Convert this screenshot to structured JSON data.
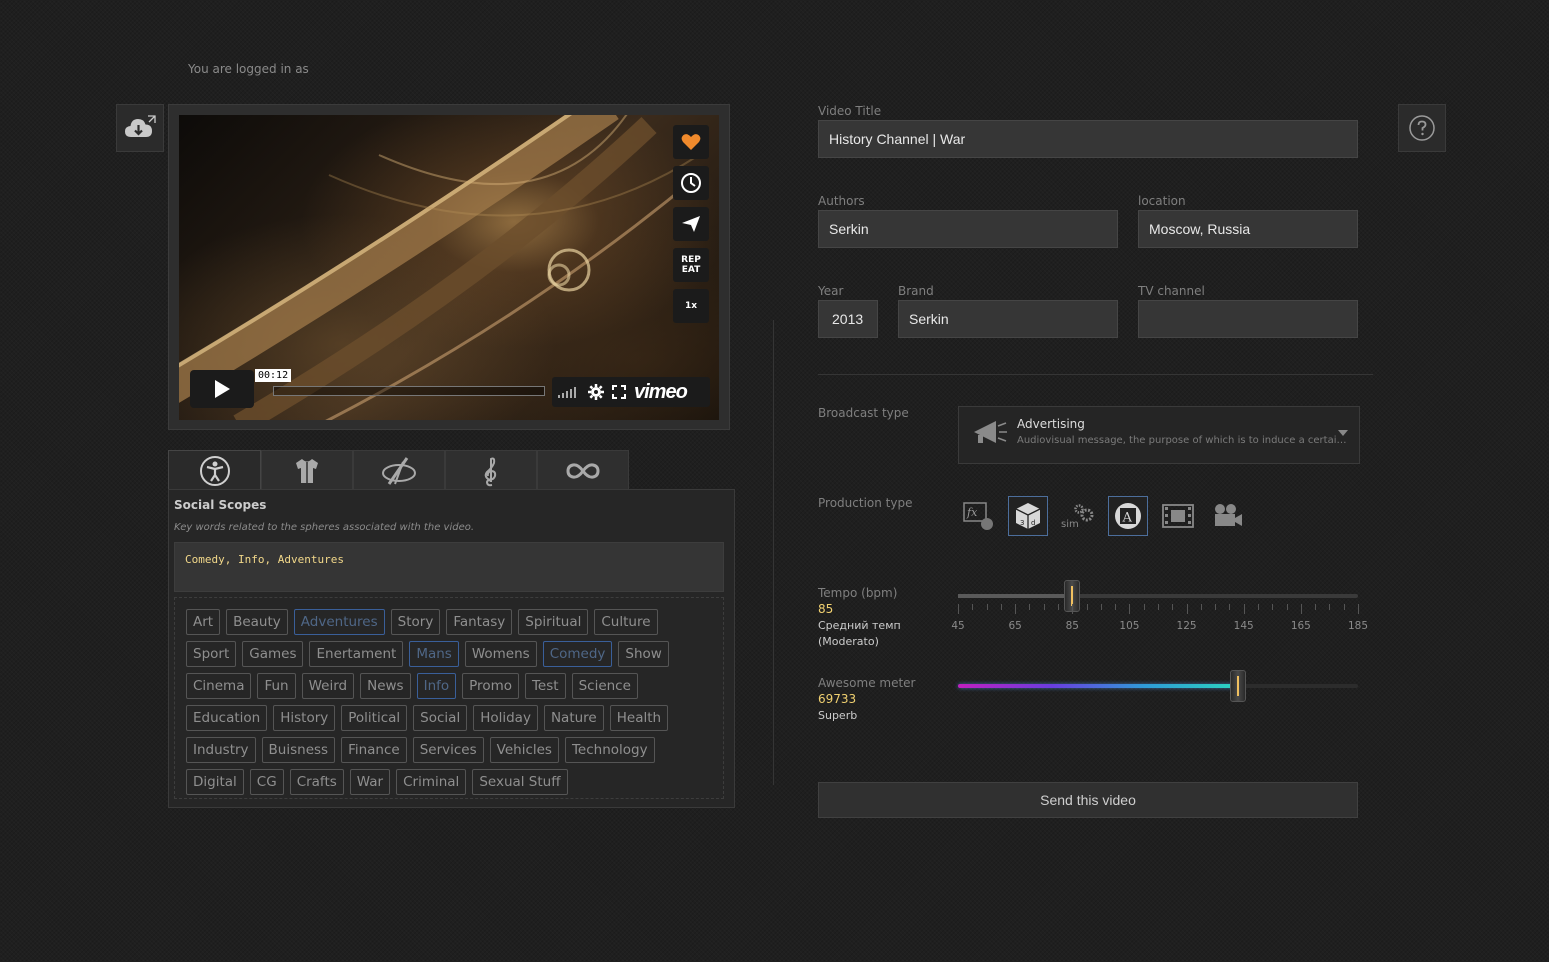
{
  "header": {
    "logged_in_text": "You are logged in as"
  },
  "player": {
    "timecode": "00:12",
    "repeat_label": "REP EAT",
    "speed_label": "1x",
    "brand": "vimeo",
    "icons": [
      "heart-icon",
      "clock-icon",
      "send-icon",
      "repeat-icon",
      "speed-icon",
      "play-icon",
      "volume-icon",
      "gear-icon",
      "fullscreen-icon"
    ],
    "heart_color": "#f08a2c"
  },
  "tabs": [
    {
      "name": "social-scopes",
      "icon": "person-icon",
      "active": true
    },
    {
      "name": "fashion",
      "icon": "shirt-icon",
      "active": false
    },
    {
      "name": "art",
      "icon": "palette-icon",
      "active": false
    },
    {
      "name": "music",
      "icon": "treble-clef-icon",
      "active": false
    },
    {
      "name": "infinity",
      "icon": "infinity-icon",
      "active": false
    }
  ],
  "social": {
    "title": "Social Scopes",
    "description": "Key words related to the spheres associated with the video.",
    "keywords": "Comedy, Info, Adventures",
    "tag_rows": [
      [
        {
          "t": "Art"
        },
        {
          "t": "Beauty"
        },
        {
          "t": "Adventures",
          "s": 1
        },
        {
          "t": "Story"
        },
        {
          "t": "Fantasy"
        },
        {
          "t": "Spiritual"
        },
        {
          "t": "Culture"
        }
      ],
      [
        {
          "t": "Sport"
        },
        {
          "t": "Games"
        },
        {
          "t": "Enertament"
        },
        {
          "t": "Mans",
          "s": 1
        },
        {
          "t": "Womens"
        },
        {
          "t": "Comedy",
          "s": 1
        },
        {
          "t": "Show"
        }
      ],
      [
        {
          "t": "Cinema"
        },
        {
          "t": "Fun"
        },
        {
          "t": "Weird"
        },
        {
          "t": "News"
        },
        {
          "t": "Info",
          "s": 1
        },
        {
          "t": "Promo"
        },
        {
          "t": "Test"
        },
        {
          "t": "Science"
        }
      ],
      [
        {
          "t": "Education"
        },
        {
          "t": "History"
        },
        {
          "t": "Political"
        },
        {
          "t": "Social"
        },
        {
          "t": "Holiday"
        },
        {
          "t": "Nature"
        },
        {
          "t": "Health"
        }
      ],
      [
        {
          "t": "Industry"
        },
        {
          "t": "Buisness"
        },
        {
          "t": "Finance"
        },
        {
          "t": "Services"
        },
        {
          "t": "Vehicles"
        },
        {
          "t": "Technology"
        }
      ],
      [
        {
          "t": "Digital"
        },
        {
          "t": "CG"
        },
        {
          "t": "Crafts"
        },
        {
          "t": "War"
        },
        {
          "t": "Criminal"
        },
        {
          "t": "Sexual Stuff"
        }
      ]
    ]
  },
  "form": {
    "video_title_label": "Video Title",
    "video_title": "History Channel | War",
    "authors_label": "Authors",
    "authors": "Serkin",
    "location_label": "location",
    "location": "Moscow, Russia",
    "year_label": "Year",
    "year": "2013",
    "brand_label": "Brand",
    "brand": "Serkin",
    "tv_label": "TV channel",
    "tv": "",
    "broadcast_label": "Broadcast type",
    "broadcast_title": "Advertising",
    "broadcast_desc": "Audiovisual message, the purpose of which is to induce a certain...",
    "production_label": "Production type",
    "production_types": [
      {
        "icon": "fx-icon",
        "selected": false
      },
      {
        "icon": "3d-cube-icon",
        "selected": true
      },
      {
        "icon": "sim-gears-icon",
        "selected": false
      },
      {
        "icon": "animation-icon",
        "selected": true
      },
      {
        "icon": "film-strip-icon",
        "selected": false
      },
      {
        "icon": "camera-icon",
        "selected": false
      }
    ],
    "tempo_label": "Tempo (bpm)",
    "tempo_value": "85",
    "tempo_desc_1": "Средний темп",
    "tempo_desc_2": "(Moderato)",
    "tempo_ticks": [
      "45",
      "65",
      "85",
      "105",
      "125",
      "145",
      "165",
      "185"
    ],
    "tempo_min": 45,
    "tempo_max": 185,
    "tempo_current": 85,
    "awesome_label": "Awesome meter",
    "awesome_value": "69733",
    "awesome_desc": "Superb",
    "awesome_fraction": 0.7,
    "send_label": "Send this video"
  }
}
